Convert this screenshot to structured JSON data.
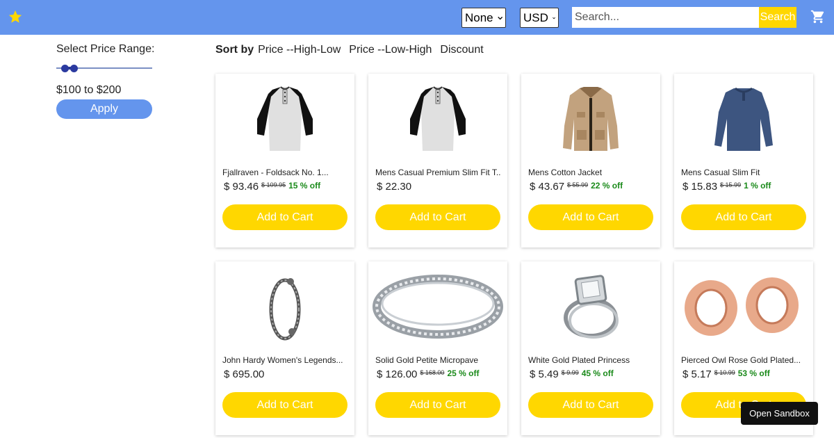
{
  "header": {
    "background": "#6495ed",
    "logo_icon": "star-icon",
    "language_select": {
      "selected": "None"
    },
    "currency_select": {
      "selected": "USD"
    },
    "search": {
      "placeholder": "Search...",
      "button_label": "Search"
    },
    "cart_icon": "cart-icon"
  },
  "sidebar": {
    "price_title": "Select Price Range:",
    "price_range_text": "$100 to $200",
    "apply_label": "Apply"
  },
  "sort": {
    "label": "Sort by",
    "options": [
      "Price --High-Low",
      "Price --Low-High",
      "Discount"
    ]
  },
  "products": [
    {
      "name": "Fjallraven - Foldsack No. 1...",
      "price": "$ 93.46",
      "old_price": "$ 109.95",
      "discount": "15 % off",
      "image": "raglan-henley-shirt",
      "button": "Add to Cart"
    },
    {
      "name": "Mens Casual Premium Slim Fit T...",
      "price": "$ 22.30",
      "old_price": "",
      "discount": "",
      "image": "raglan-henley-shirt",
      "button": "Add to Cart"
    },
    {
      "name": "Mens Cotton Jacket",
      "price": "$ 43.67",
      "old_price": "$ 55.99",
      "discount": "22 % off",
      "image": "cotton-jacket",
      "button": "Add to Cart"
    },
    {
      "name": "Mens Casual Slim Fit",
      "price": "$ 15.83",
      "old_price": "$ 15.99",
      "discount": "1 % off",
      "image": "long-sleeve-tee",
      "button": "Add to Cart"
    },
    {
      "name": "John Hardy Women's Legends...",
      "price": "$ 695.00",
      "old_price": "",
      "discount": "",
      "image": "dragon-bracelet",
      "button": "Add to Cart"
    },
    {
      "name": "Solid Gold Petite Micropave",
      "price": "$ 126.00",
      "old_price": "$ 168.00",
      "discount": "25 % off",
      "image": "silver-band-ring",
      "button": "Add to Cart"
    },
    {
      "name": "White Gold Plated Princess",
      "price": "$ 5.49",
      "old_price": "$ 9.99",
      "discount": "45 % off",
      "image": "princess-ring",
      "button": "Add to Cart"
    },
    {
      "name": "Pierced Owl Rose Gold Plated...",
      "price": "$ 5.17",
      "old_price": "$ 10.99",
      "discount": "53 % off",
      "image": "rose-gold-plugs",
      "button": "Add to Cart"
    }
  ],
  "overlay": {
    "sandbox_label": "Open Sandbox"
  },
  "colors": {
    "accent": "#6495ed",
    "button": "#ffd700",
    "discount": "#1a8a1a"
  }
}
